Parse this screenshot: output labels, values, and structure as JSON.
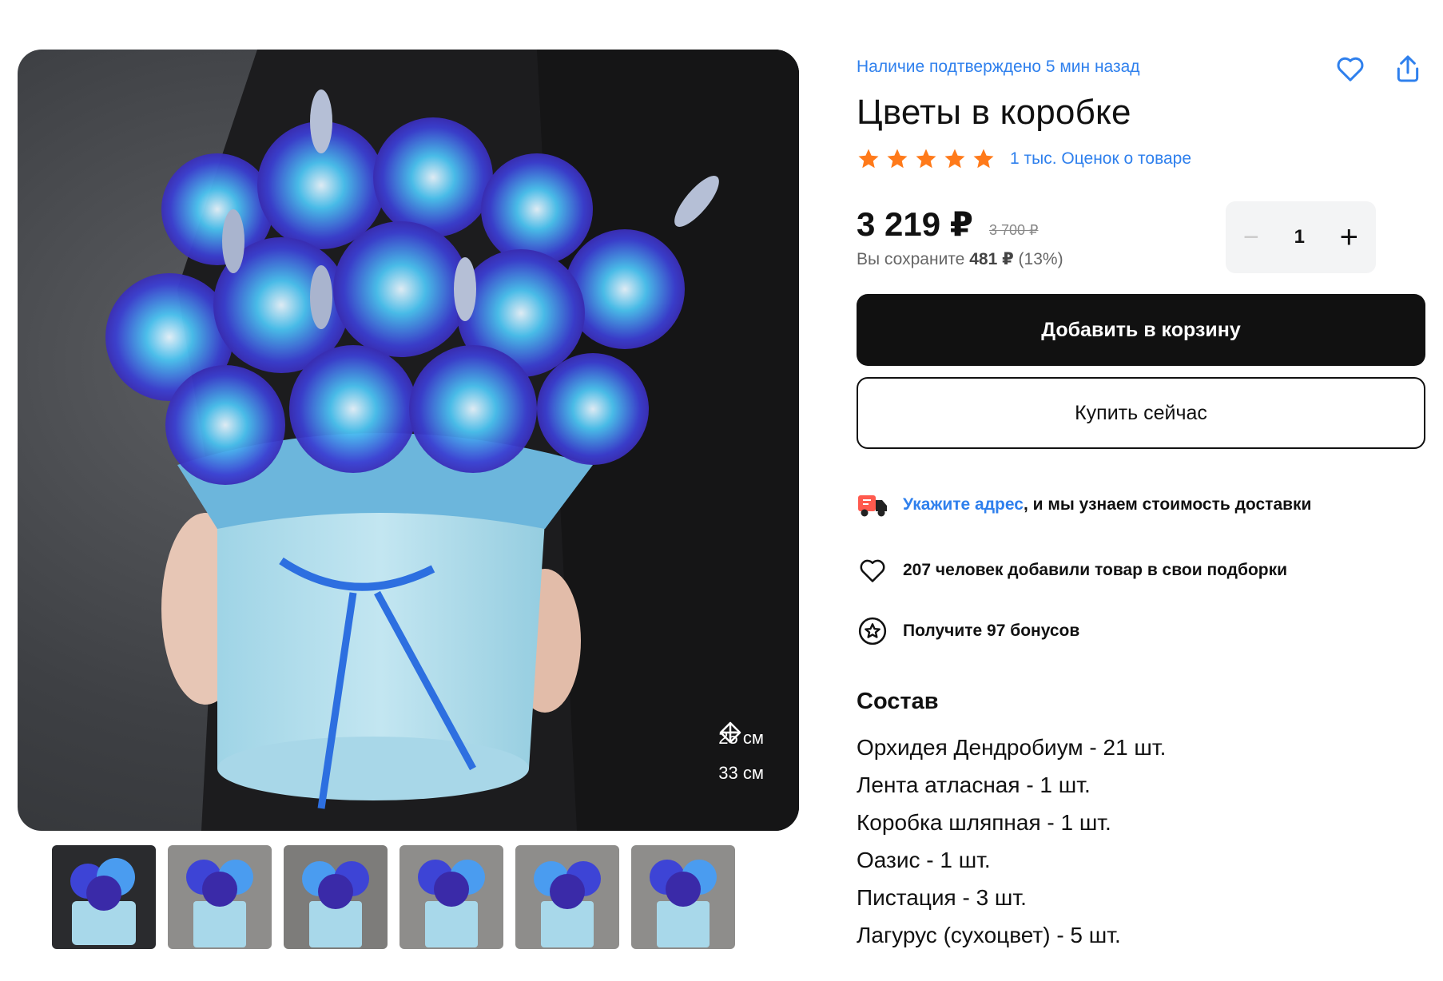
{
  "gallery": {
    "dimensions": {
      "width": "25 см",
      "height": "33 см"
    },
    "thumbnails": [
      "thumb-1",
      "thumb-2",
      "thumb-3",
      "thumb-4",
      "thumb-5",
      "thumb-6"
    ]
  },
  "product": {
    "availability": "Наличие подтверждено 5 мин назад",
    "title": "Цветы в коробке",
    "rating": {
      "stars": 5,
      "link_text": "1 тыс. Оценок о товаре"
    },
    "price": "3 219 ₽",
    "old_price": "3 700 ₽",
    "save_prefix": "Вы сохраните",
    "save_amount": "481 ₽",
    "save_percent": "(13%)",
    "quantity": {
      "minus": "−",
      "value": "1",
      "plus": "+"
    },
    "add_to_cart_label": "Добавить в корзину",
    "buy_now_label": "Купить сейчас"
  },
  "info": {
    "delivery_link": "Укажите адрес",
    "delivery_rest": ", и мы узнаем стоимость доставки",
    "favorites": "207 человек добавили товар в свои подборки",
    "bonuses": "Получите 97 бонусов"
  },
  "composition": {
    "title": "Состав",
    "items": [
      "Орхидея Дендробиум - 21 шт.",
      "Лента атласная - 1 шт.",
      "Коробка шляпная - 1 шт.",
      "Оазис - 1 шт.",
      "Пистация - 3 шт.",
      "Лагурус (сухоцвет) - 5 шт."
    ]
  },
  "colors": {
    "accent_link": "#2f80ed",
    "star": "#ff7a1a",
    "primary_button": "#111111"
  },
  "icons": [
    "heart-icon",
    "share-icon",
    "star-icon",
    "delivery-truck-icon",
    "heart-outline-icon",
    "bonus-star-icon",
    "width-arrows-icon",
    "height-arrows-icon"
  ]
}
